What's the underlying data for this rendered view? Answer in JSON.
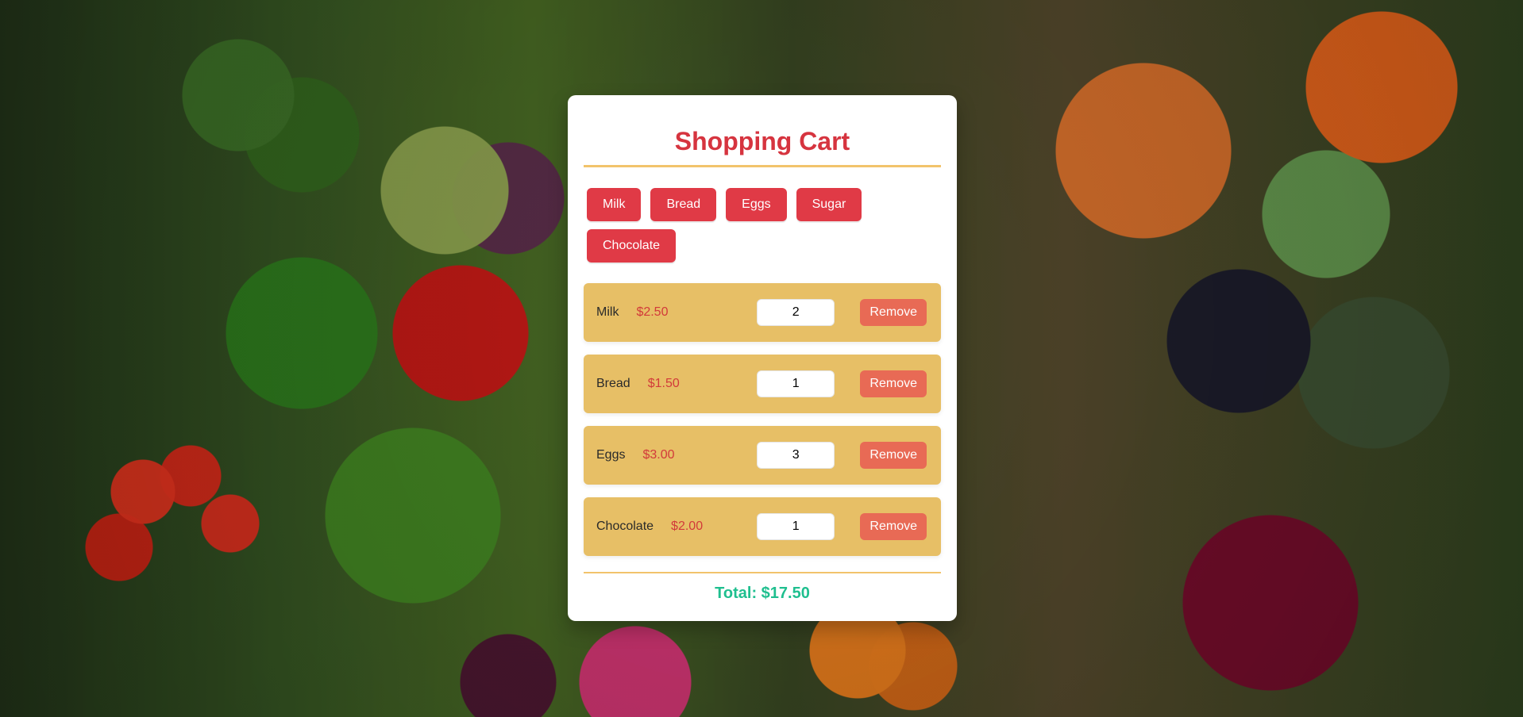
{
  "colors": {
    "title": "#d6343f",
    "accent_border": "#f2c36b",
    "chip_bg": "#e03a46",
    "chip_text": "#ffffff",
    "item_bg": "#e7bf66",
    "price": "#d23a3a",
    "remove_bg": "#e86a55",
    "total": "#1fbf8f"
  },
  "cart": {
    "title": "Shopping Cart",
    "suggestions": [
      {
        "label": "Milk"
      },
      {
        "label": "Bread"
      },
      {
        "label": "Eggs"
      },
      {
        "label": "Sugar"
      },
      {
        "label": "Chocolate"
      }
    ],
    "items": [
      {
        "name": "Milk",
        "price": "$2.50",
        "qty": "2",
        "remove_label": "Remove"
      },
      {
        "name": "Bread",
        "price": "$1.50",
        "qty": "1",
        "remove_label": "Remove"
      },
      {
        "name": "Eggs",
        "price": "$3.00",
        "qty": "3",
        "remove_label": "Remove"
      },
      {
        "name": "Chocolate",
        "price": "$2.00",
        "qty": "1",
        "remove_label": "Remove"
      }
    ],
    "total_text": "Total: $17.50"
  }
}
